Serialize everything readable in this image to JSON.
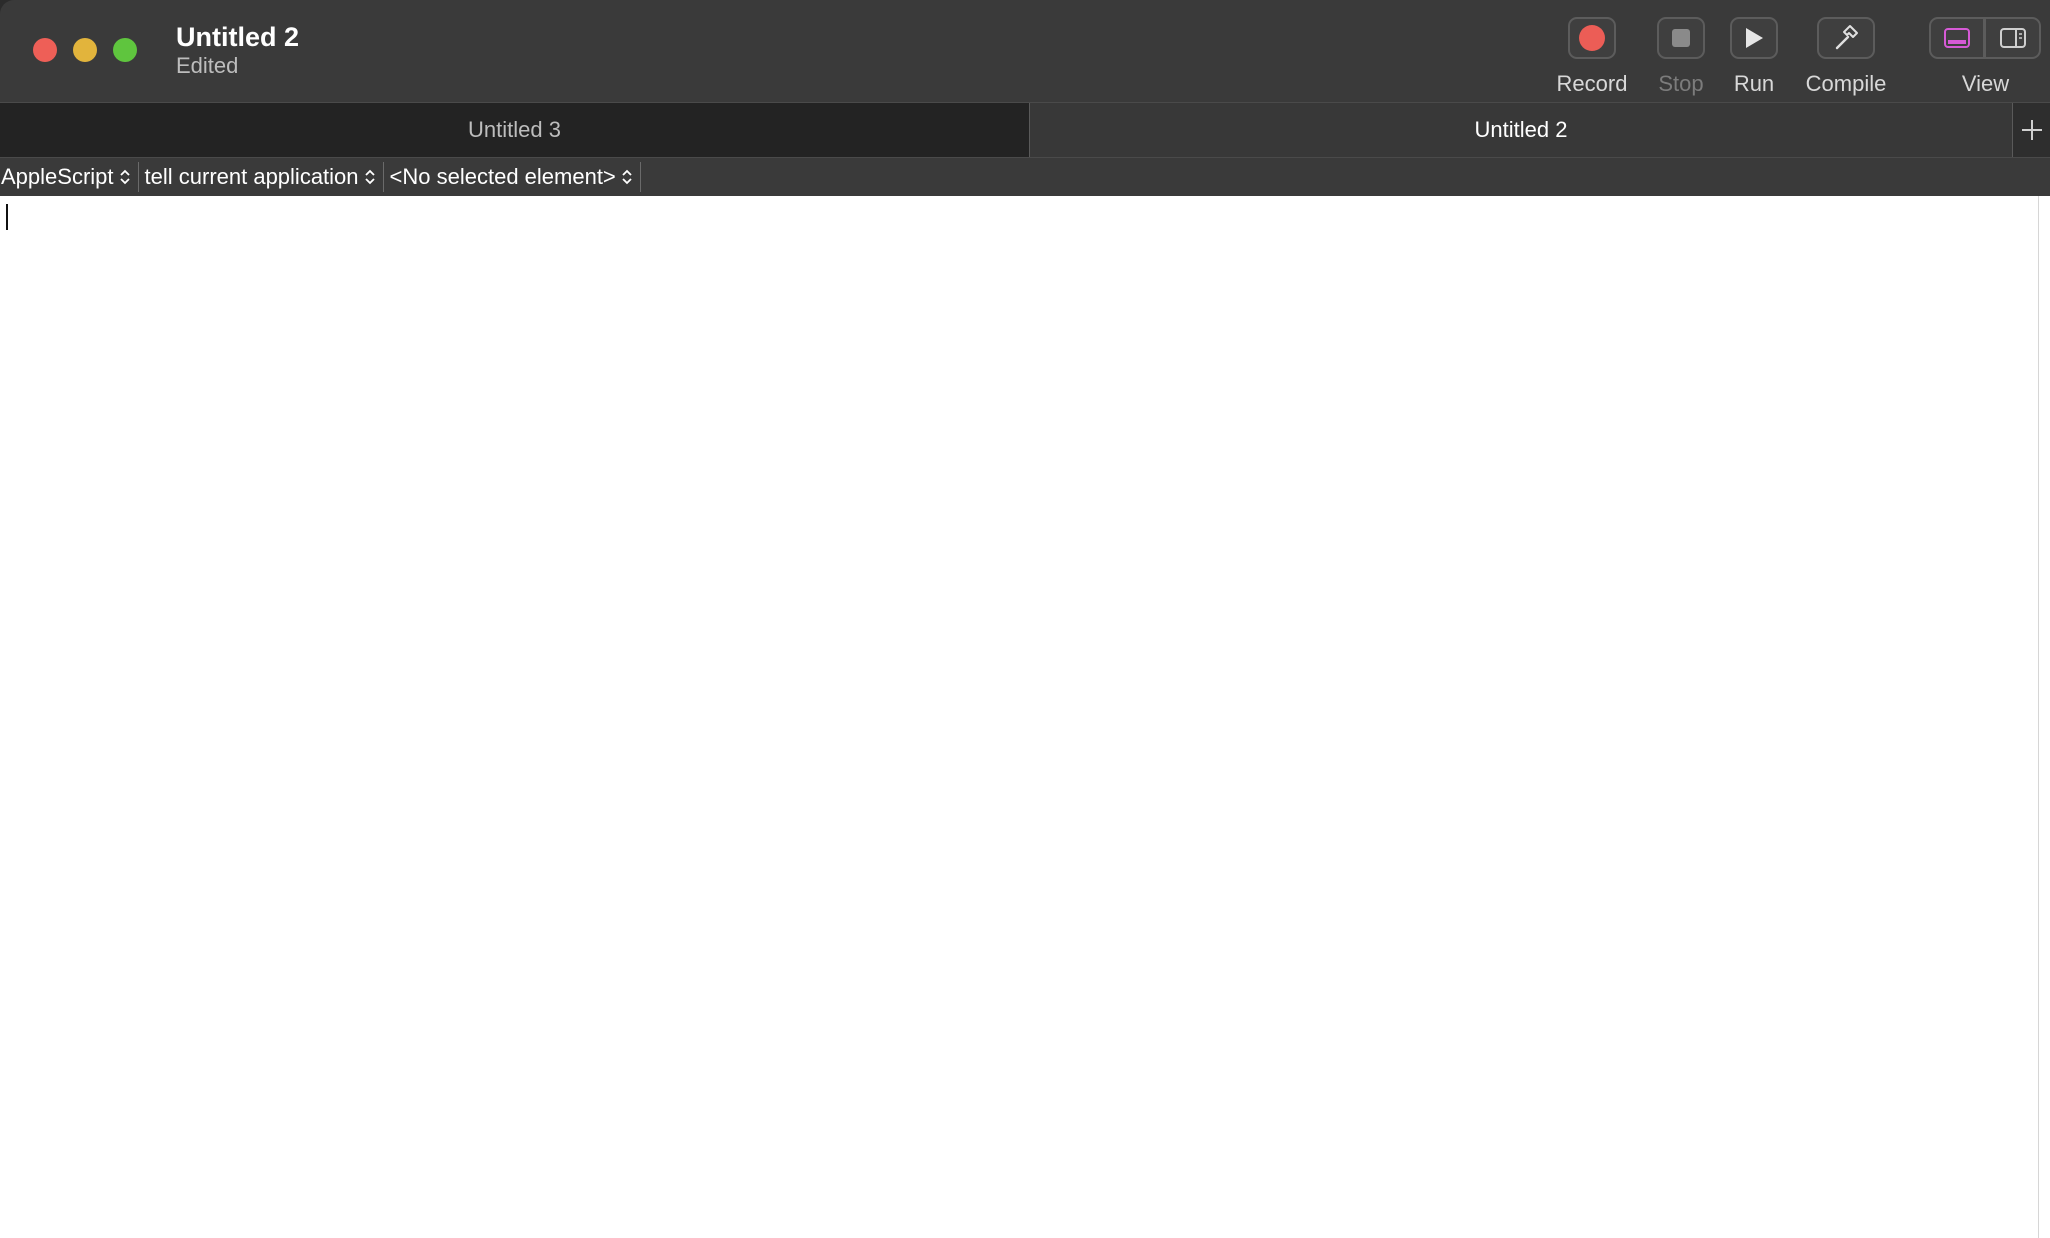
{
  "window": {
    "title": "Untitled 2",
    "subtitle": "Edited"
  },
  "toolbar": {
    "record_label": "Record",
    "stop_label": "Stop",
    "run_label": "Run",
    "compile_label": "Compile",
    "view_label": "View",
    "record_color": "#ec5d56",
    "view_active_color": "#d65ad6"
  },
  "tabs": [
    {
      "label": "Untitled 3",
      "active": false
    },
    {
      "label": "Untitled 2",
      "active": true
    }
  ],
  "tab_add_icon": "plus-icon",
  "navigation": {
    "language": "AppleScript",
    "target": "tell current application",
    "element": "<No selected element>"
  },
  "editor": {
    "content": ""
  }
}
